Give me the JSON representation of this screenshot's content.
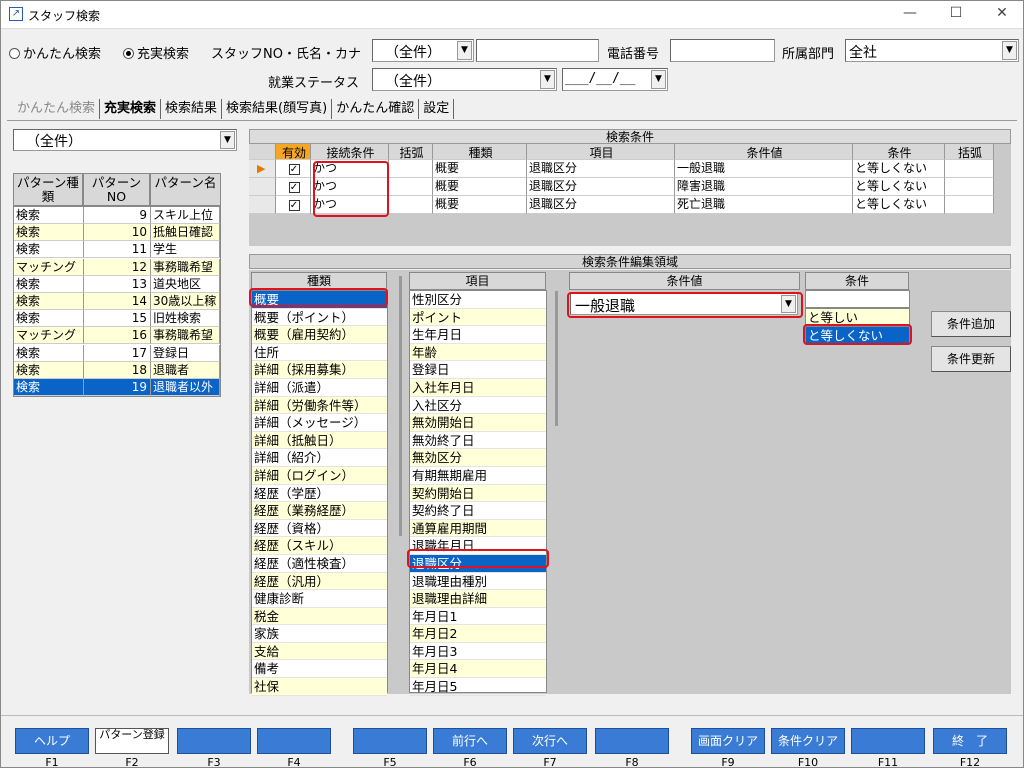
{
  "window": {
    "title": "スタッフ検索",
    "minimize": "—",
    "maximize": "☐",
    "close": "✕"
  },
  "search": {
    "mode_simple": "かんたん検索",
    "mode_full": "充実検索",
    "staff_label": "スタッフNO・氏名・カナ",
    "staff_combo": "（全件）",
    "phone_label": "電話番号",
    "dept_label": "所属部門",
    "dept_value": "全社",
    "status_label": "就業ステータス",
    "status_value": "（全件）",
    "date_value": "___/__/__"
  },
  "tabs": [
    {
      "label": "かんたん検索",
      "state": "disabled"
    },
    {
      "label": "充実検索",
      "state": "active"
    },
    {
      "label": "検索結果",
      "state": "normal"
    },
    {
      "label": "検索結果(顔写真)",
      "state": "normal"
    },
    {
      "label": "かんたん確認",
      "state": "normal"
    },
    {
      "label": "設定",
      "state": "normal"
    }
  ],
  "pattern": {
    "combo": "（全件）",
    "headers": [
      "パターン種類",
      "パターンNO",
      "パターン名"
    ],
    "rows": [
      [
        "検索",
        "9",
        "スキル上位"
      ],
      [
        "検索",
        "10",
        "抵触日確認"
      ],
      [
        "検索",
        "11",
        "学生"
      ],
      [
        "マッチング",
        "12",
        "事務職希望"
      ],
      [
        "検索",
        "13",
        "道央地区"
      ],
      [
        "検索",
        "14",
        "30歳以上稼"
      ],
      [
        "検索",
        "15",
        "旧姓検索"
      ],
      [
        "マッチング",
        "16",
        "事務職希望"
      ],
      [
        "検索",
        "17",
        "登録日"
      ],
      [
        "検索",
        "18",
        "退職者"
      ],
      [
        "検索",
        "19",
        "退職者以外"
      ]
    ]
  },
  "conditions": {
    "title": "検索条件",
    "headers": [
      "有効",
      "接続条件",
      "括弧",
      "種類",
      "項目",
      "条件値",
      "条件",
      "括弧"
    ],
    "rows": [
      {
        "check": "✓",
        "conn": "かつ",
        "type": "概要",
        "item": "退職区分",
        "value": "一般退職",
        "cond": "と等しくない"
      },
      {
        "check": "✓",
        "conn": "かつ",
        "type": "概要",
        "item": "退職区分",
        "value": "障害退職",
        "cond": "と等しくない"
      },
      {
        "check": "✓",
        "conn": "かつ",
        "type": "概要",
        "item": "退職区分",
        "value": "死亡退職",
        "cond": "と等しくない"
      }
    ]
  },
  "edit": {
    "title": "検索条件編集領域",
    "type_header": "種類",
    "types": [
      "概要",
      "概要（ポイント）",
      "概要（雇用契約）",
      "住所",
      "詳細（採用募集）",
      "詳細（派遣）",
      "詳細（労働条件等）",
      "詳細（メッセージ）",
      "詳細（抵触日）",
      "詳細（紹介）",
      "詳細（ログイン）",
      "経歴（学歴）",
      "経歴（業務経歴）",
      "経歴（資格）",
      "経歴（スキル）",
      "経歴（適性検査）",
      "経歴（汎用）",
      "健康診断",
      "税金",
      "家族",
      "支給",
      "備考",
      "社保"
    ],
    "item_header": "項目",
    "items": [
      "性別区分",
      "ポイント",
      "生年月日",
      "年齢",
      "登録日",
      "入社年月日",
      "入社区分",
      "無効開始日",
      "無効終了日",
      "無効区分",
      "有期無期雇用",
      "契約開始日",
      "契約終了日",
      "通算雇用期間",
      "退職年月日",
      "退職区分",
      "退職理由種別",
      "退職理由詳細",
      "年月日1",
      "年月日2",
      "年月日3",
      "年月日4",
      "年月日5"
    ],
    "value_header": "条件値",
    "value_combo": "一般退職",
    "cond_header": "条件",
    "conds": [
      "と等しい",
      "と等しくない"
    ],
    "add_button": "条件追加",
    "update_button": "条件更新"
  },
  "fkeys": [
    {
      "label": "ヘルプ",
      "key": "F1"
    },
    {
      "label": "パターン登録",
      "key": "F2"
    },
    {
      "label": "",
      "key": "F3"
    },
    {
      "label": "",
      "key": "F4"
    },
    {
      "label": "",
      "key": "F5"
    },
    {
      "label": "前行へ",
      "key": "F6"
    },
    {
      "label": "次行へ",
      "key": "F7"
    },
    {
      "label": "",
      "key": "F8"
    },
    {
      "label": "画面クリア",
      "key": "F9"
    },
    {
      "label": "条件クリア",
      "key": "F10"
    },
    {
      "label": "",
      "key": "F11"
    },
    {
      "label": "終　了",
      "key": "F12"
    }
  ]
}
